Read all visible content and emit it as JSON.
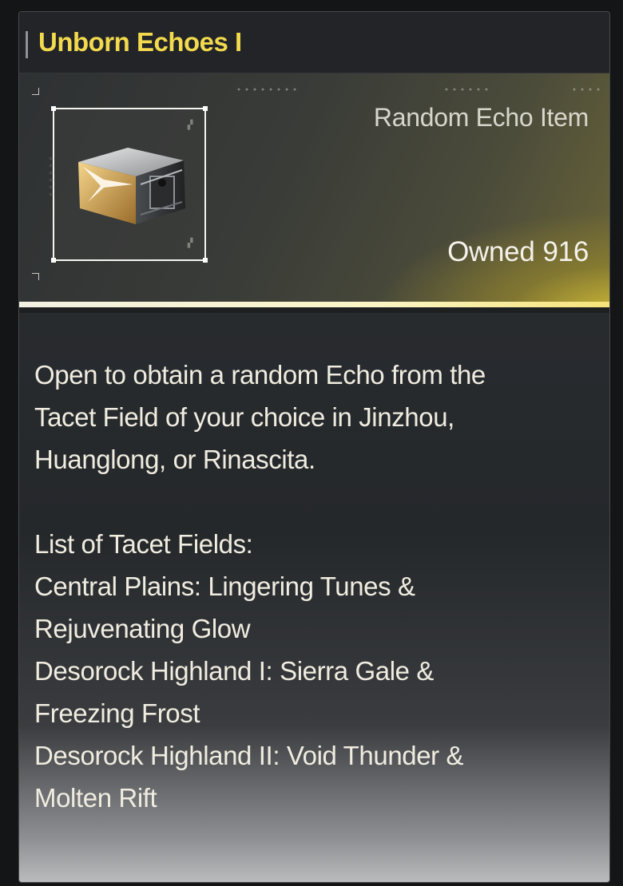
{
  "title": "Unborn Echoes I",
  "item": {
    "type": "Random Echo Item",
    "owned_label": "Owned",
    "owned_count": "916",
    "icon": "supply-chest-icon"
  },
  "description": {
    "lines": [
      "Open to obtain a random Echo from the",
      "Tacet Field of your choice in Jinzhou,",
      "Huanglong, or Rinascita."
    ],
    "list_heading": "List of Tacet Fields:",
    "list_lines": [
      "Central Plains: Lingering Tunes &",
      "Rejuvenating Glow",
      "Desorock Highland I: Sierra Gale &",
      "Freezing Frost",
      "Desorock Highland II: Void Thunder &",
      "Molten Rift"
    ]
  },
  "colors": {
    "title": "#f2d94e",
    "accent_glow": "#d4be38",
    "text": "#f0ece0"
  }
}
